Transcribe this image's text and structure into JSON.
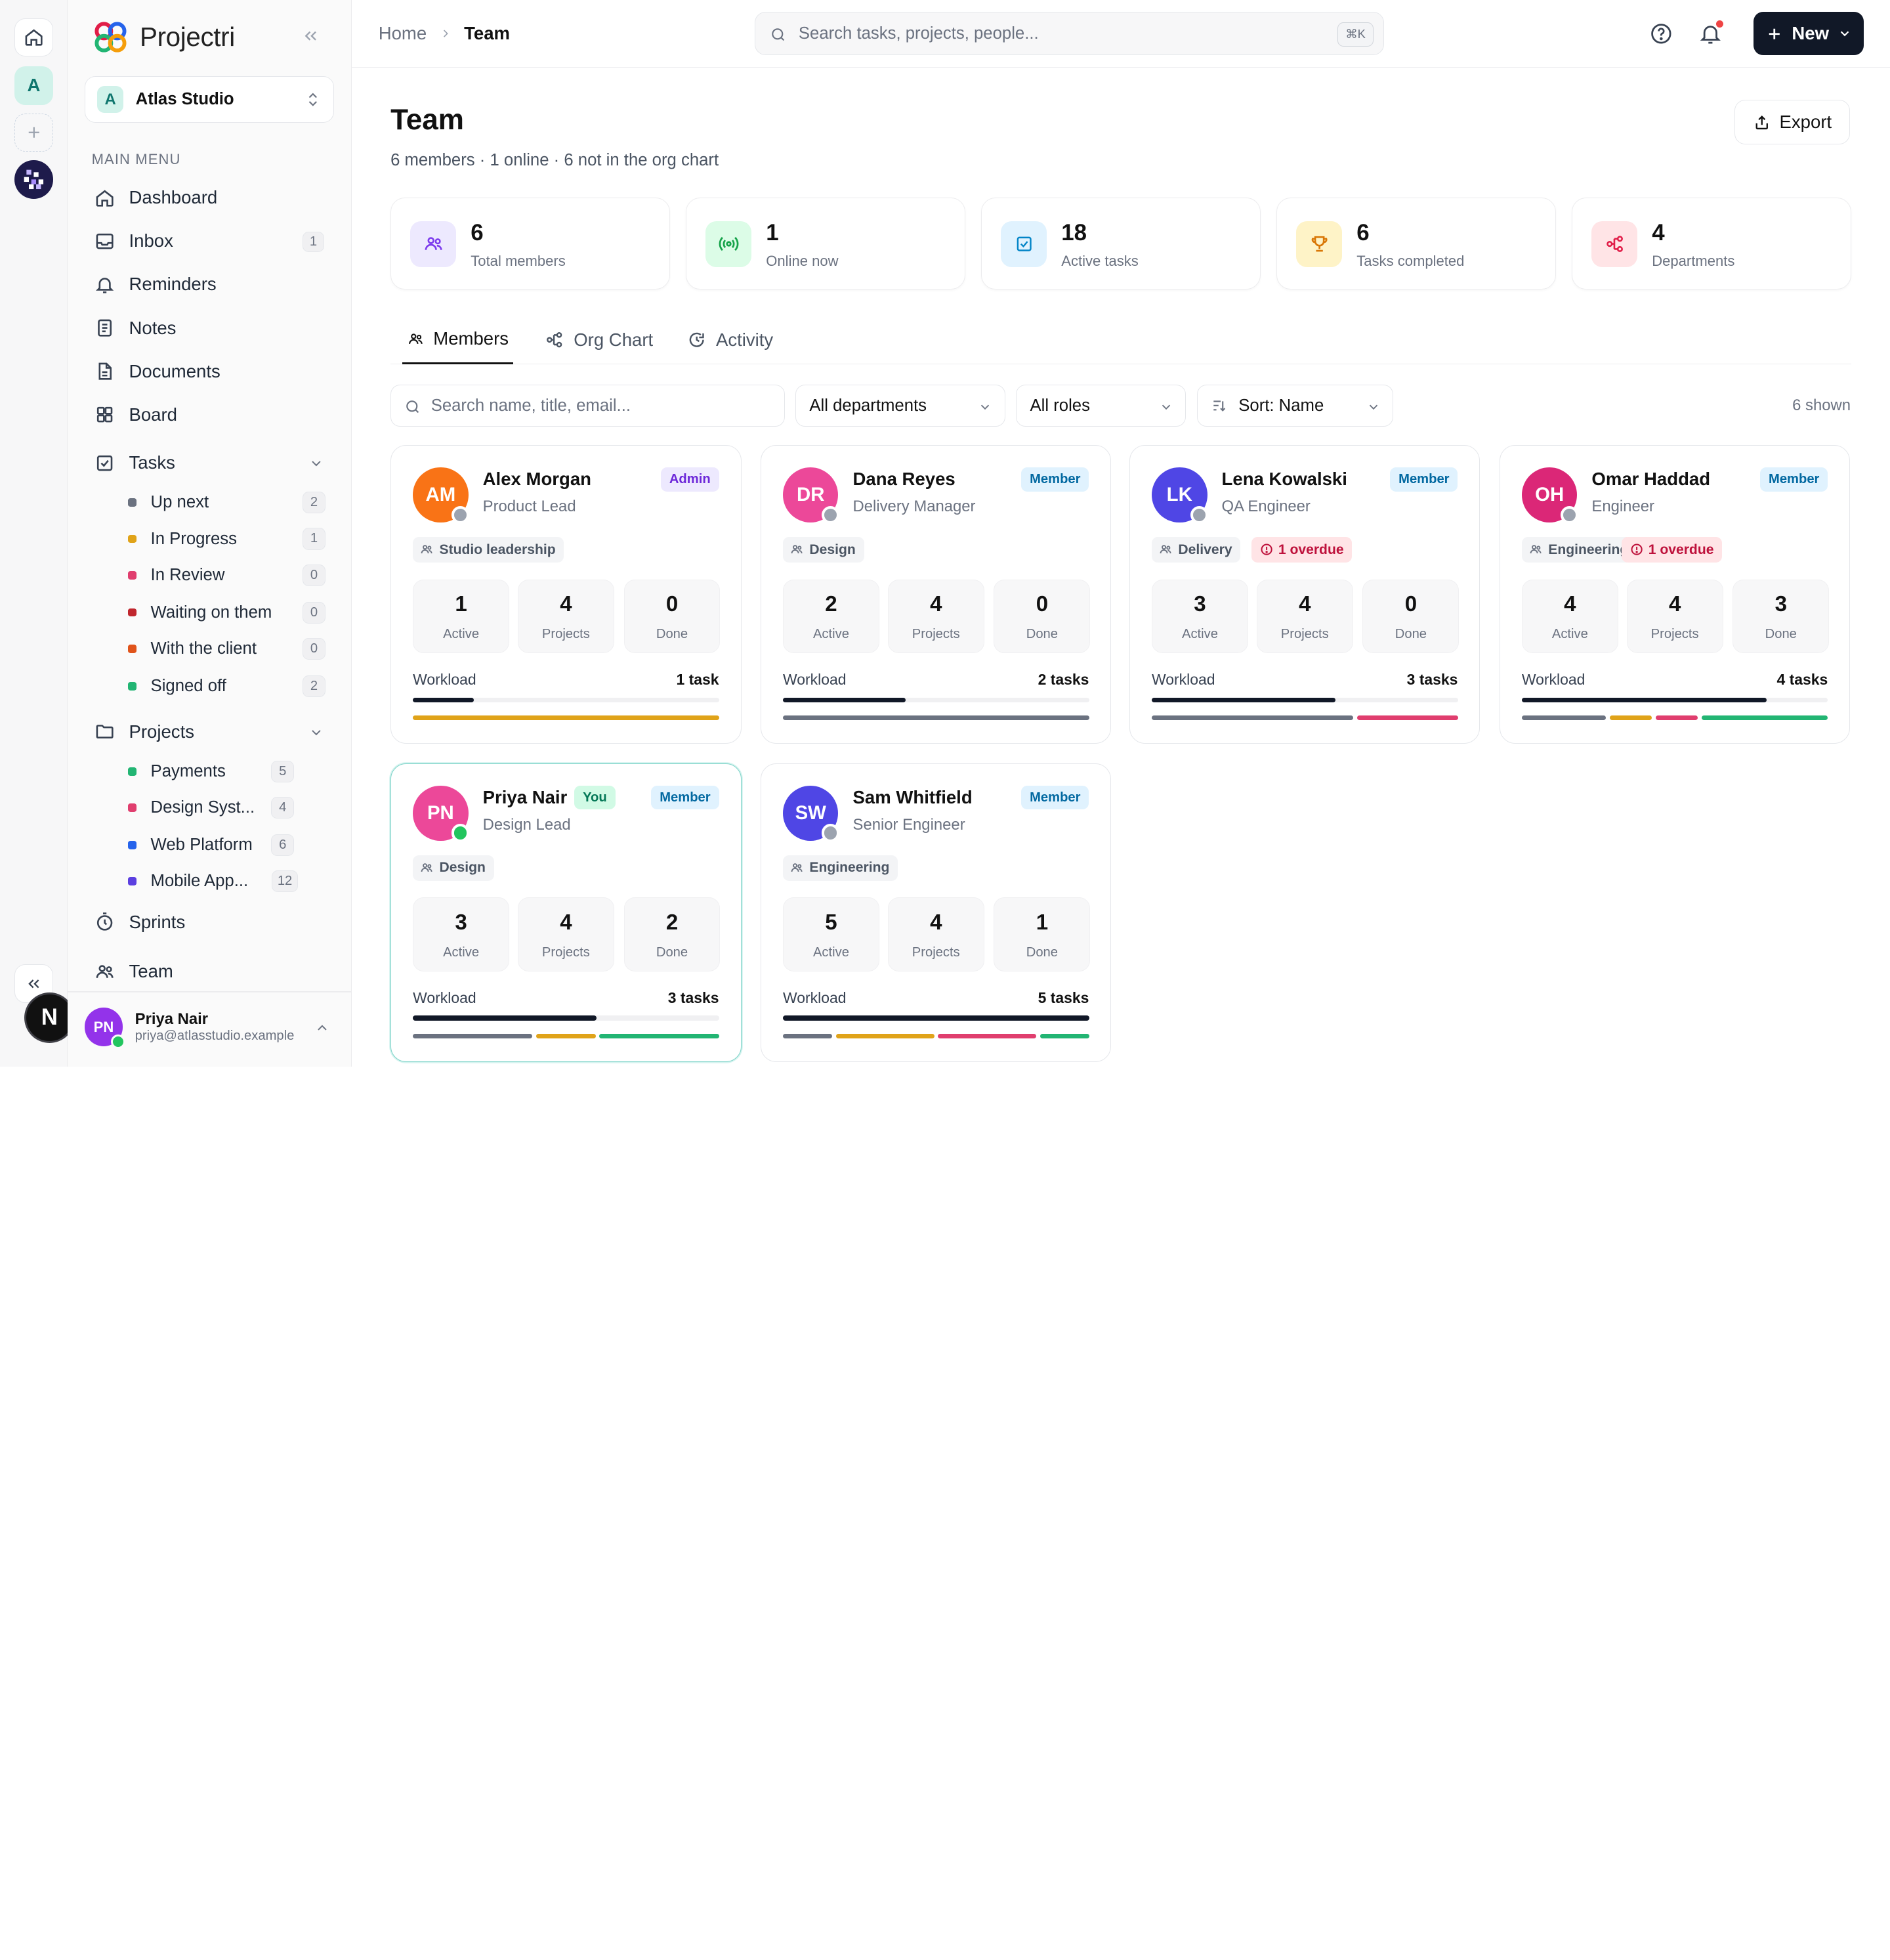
{
  "app": {
    "name": "Projectri"
  },
  "rail": {
    "workspace_initial": "A",
    "footer_badge": "N"
  },
  "workspace": {
    "badge": "A",
    "name": "Atlas Studio"
  },
  "sidebar": {
    "menu_label": "MAIN MENU",
    "items": [
      {
        "label": "Dashboard",
        "icon": "home-icon"
      },
      {
        "label": "Inbox",
        "icon": "inbox-icon",
        "count": "1"
      },
      {
        "label": "Reminders",
        "icon": "bell-icon"
      },
      {
        "label": "Notes",
        "icon": "note-icon"
      },
      {
        "label": "Documents",
        "icon": "document-icon"
      },
      {
        "label": "Board",
        "icon": "board-icon"
      },
      {
        "label": "Tasks",
        "icon": "checkbox-icon"
      },
      {
        "label": "Projects",
        "icon": "folder-icon"
      },
      {
        "label": "Sprints",
        "icon": "stopwatch-icon"
      },
      {
        "label": "Team",
        "icon": "team-icon"
      }
    ],
    "tasks": [
      {
        "label": "Up next",
        "count": "2",
        "color": "#6b7280"
      },
      {
        "label": "In Progress",
        "count": "1",
        "color": "#e0a319"
      },
      {
        "label": "In Review",
        "count": "0",
        "color": "#e03e6e"
      },
      {
        "label": "Waiting on them",
        "count": "0",
        "color": "#c0262d"
      },
      {
        "label": "With the client",
        "count": "0",
        "color": "#e0531a"
      },
      {
        "label": "Signed off",
        "count": "2",
        "color": "#22b573"
      }
    ],
    "projects": [
      {
        "label": "Payments",
        "count": "5",
        "color": "#22b573"
      },
      {
        "label": "Design Syst...",
        "count": "4",
        "color": "#e03e6e"
      },
      {
        "label": "Web Platform",
        "count": "6",
        "color": "#2563eb"
      },
      {
        "label": "Mobile App...",
        "count": "12",
        "color": "#5b3fe0"
      }
    ]
  },
  "user": {
    "initials": "PN",
    "name": "Priya Nair",
    "email": "priya@atlasstudio.example"
  },
  "topbar": {
    "breadcrumb": [
      "Home",
      "Team"
    ],
    "search_placeholder": "Search tasks, projects, people...",
    "search_shortcut": "⌘K",
    "new_label": "New"
  },
  "page": {
    "title": "Team",
    "subtitle": "6 members · 1 online · 6 not in the org chart",
    "export_label": "Export"
  },
  "stats": [
    {
      "value": "6",
      "label": "Total members",
      "icon": "users-icon",
      "bg": "#ede9fe",
      "fg": "#7c3aed"
    },
    {
      "value": "1",
      "label": "Online now",
      "icon": "broadcast-icon",
      "bg": "#dcfce7",
      "fg": "#16a34a"
    },
    {
      "value": "18",
      "label": "Active tasks",
      "icon": "checkbox-icon",
      "bg": "#e0f2fe",
      "fg": "#0284c7"
    },
    {
      "value": "6",
      "label": "Tasks completed",
      "icon": "trophy-icon",
      "bg": "#fef3c7",
      "fg": "#d97706"
    },
    {
      "value": "4",
      "label": "Departments",
      "icon": "org-icon",
      "bg": "#ffe4e6",
      "fg": "#e11d48"
    }
  ],
  "tabs": [
    {
      "label": "Members",
      "icon": "users-icon",
      "active": true
    },
    {
      "label": "Org Chart",
      "icon": "org-icon"
    },
    {
      "label": "Activity",
      "icon": "activity-icon"
    }
  ],
  "filters": {
    "search_placeholder": "Search name, title, email...",
    "department": "All departments",
    "role": "All roles",
    "sort": "Sort: Name",
    "shown": "6 shown"
  },
  "members": [
    {
      "initials": "AM",
      "color": "#f97316",
      "name": "Alex Morgan",
      "title": "Product Lead",
      "role": "Admin",
      "role_type": "admin",
      "dept": "Studio leadership",
      "online": false,
      "you": false,
      "overdue": "",
      "stats": [
        {
          "v": "1",
          "l": "Active"
        },
        {
          "v": "4",
          "l": "Projects"
        },
        {
          "v": "0",
          "l": "Done"
        }
      ],
      "workload_label": "Workload",
      "workload": "1 task",
      "load": 0.2,
      "segments": [
        {
          "w": 1,
          "c": "#e0a319"
        }
      ]
    },
    {
      "initials": "DR",
      "color": "#ec4899",
      "name": "Dana Reyes",
      "title": "Delivery Manager",
      "role": "Member",
      "role_type": "member",
      "dept": "Design",
      "online": false,
      "you": false,
      "overdue": "",
      "stats": [
        {
          "v": "2",
          "l": "Active"
        },
        {
          "v": "4",
          "l": "Projects"
        },
        {
          "v": "0",
          "l": "Done"
        }
      ],
      "workload_label": "Workload",
      "workload": "2 tasks",
      "load": 0.4,
      "segments": [
        {
          "w": 1,
          "c": "#6b7280"
        }
      ]
    },
    {
      "initials": "LK",
      "color": "#4f46e5",
      "name": "Lena Kowalski",
      "title": "QA Engineer",
      "role": "Member",
      "role_type": "member",
      "dept": "Delivery",
      "online": false,
      "you": false,
      "overdue": "1 overdue",
      "stats": [
        {
          "v": "3",
          "l": "Active"
        },
        {
          "v": "4",
          "l": "Projects"
        },
        {
          "v": "0",
          "l": "Done"
        }
      ],
      "workload_label": "Workload",
      "workload": "3 tasks",
      "load": 0.6,
      "segments": [
        {
          "w": 2,
          "c": "#6b7280"
        },
        {
          "w": 1,
          "c": "#e03e6e"
        }
      ]
    },
    {
      "initials": "OH",
      "color": "#db2777",
      "name": "Omar Haddad",
      "title": "Engineer",
      "role": "Member",
      "role_type": "member",
      "dept": "Engineering",
      "online": false,
      "you": false,
      "overdue": "1 overdue",
      "stats": [
        {
          "v": "4",
          "l": "Active"
        },
        {
          "v": "4",
          "l": "Projects"
        },
        {
          "v": "3",
          "l": "Done"
        }
      ],
      "workload_label": "Workload",
      "workload": "4 tasks",
      "load": 0.8,
      "segments": [
        {
          "w": 2,
          "c": "#6b7280"
        },
        {
          "w": 1,
          "c": "#e0a319"
        },
        {
          "w": 1,
          "c": "#e03e6e"
        },
        {
          "w": 3,
          "c": "#22b573"
        }
      ]
    },
    {
      "initials": "PN",
      "color": "#ec4899",
      "name": "Priya Nair",
      "title": "Design Lead",
      "role": "Member",
      "role_type": "member",
      "dept": "Design",
      "online": true,
      "you": true,
      "you_label": "You",
      "overdue": "",
      "stats": [
        {
          "v": "3",
          "l": "Active"
        },
        {
          "v": "4",
          "l": "Projects"
        },
        {
          "v": "2",
          "l": "Done"
        }
      ],
      "workload_label": "Workload",
      "workload": "3 tasks",
      "load": 0.6,
      "segments": [
        {
          "w": 2,
          "c": "#6b7280"
        },
        {
          "w": 1,
          "c": "#e0a319"
        },
        {
          "w": 2,
          "c": "#22b573"
        }
      ]
    },
    {
      "initials": "SW",
      "color": "#4f46e5",
      "name": "Sam Whitfield",
      "title": "Senior Engineer",
      "role": "Member",
      "role_type": "member",
      "dept": "Engineering",
      "online": false,
      "you": false,
      "overdue": "",
      "stats": [
        {
          "v": "5",
          "l": "Active"
        },
        {
          "v": "4",
          "l": "Projects"
        },
        {
          "v": "1",
          "l": "Done"
        }
      ],
      "workload_label": "Workload",
      "workload": "5 tasks",
      "load": 1.0,
      "segments": [
        {
          "w": 1,
          "c": "#6b7280"
        },
        {
          "w": 2,
          "c": "#e0a319"
        },
        {
          "w": 2,
          "c": "#e03e6e"
        },
        {
          "w": 1,
          "c": "#22b573"
        }
      ]
    }
  ]
}
